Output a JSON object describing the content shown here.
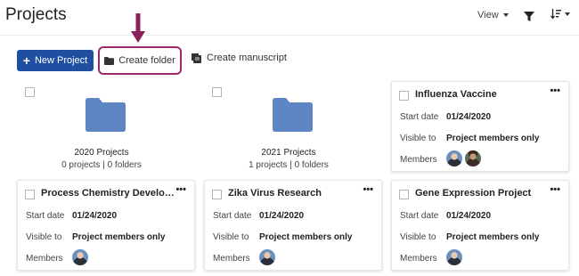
{
  "header": {
    "title": "Projects",
    "view_label": "View"
  },
  "toolbar": {
    "new_project_label": "New Project",
    "create_folder_label": "Create folder",
    "create_manuscript_label": "Create manuscript"
  },
  "folders": [
    {
      "name": "2020 Projects",
      "meta": "0 projects | 0 folders"
    },
    {
      "name": "2021 Projects",
      "meta": "1 projects | 0 folders"
    }
  ],
  "card_labels": {
    "start_date": "Start date",
    "visible_to": "Visible to",
    "members": "Members"
  },
  "projects": [
    {
      "title": "Influenza Vaccine",
      "start_date": "01/24/2020",
      "visible_to": "Project members only",
      "member_count": 2
    },
    {
      "title": "Process Chemistry Development",
      "start_date": "01/24/2020",
      "visible_to": "Project members only",
      "member_count": 1
    },
    {
      "title": "Zika Virus Research",
      "start_date": "01/24/2020",
      "visible_to": "Project members only",
      "member_count": 1
    },
    {
      "title": "Gene Expression Project",
      "start_date": "01/24/2020",
      "visible_to": "Project members only",
      "member_count": 1
    }
  ],
  "icons": {
    "filter": "filter-icon",
    "sort": "sort-icon",
    "folder": "folder-icon",
    "manuscript": "manuscript-icon",
    "more": "more-icon",
    "arrow": "arrow-down-icon"
  },
  "colors": {
    "primary_button": "#1f4fa0",
    "highlight_border": "#9b2a6b",
    "arrow": "#8b1f5c",
    "folder": "#5f86c4"
  }
}
